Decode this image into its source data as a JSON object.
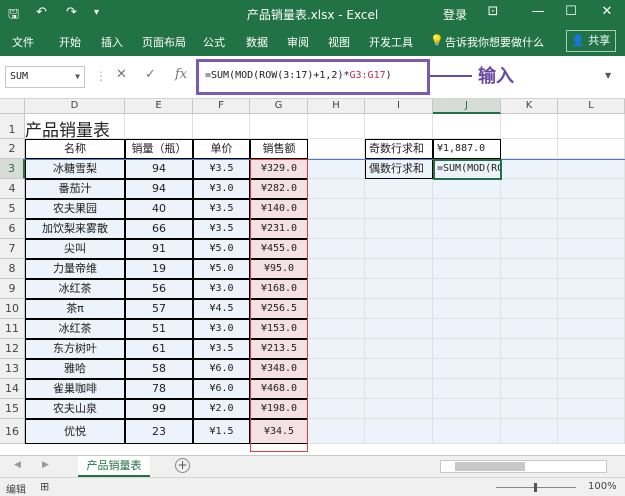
{
  "window": {
    "title": "产品销量表.xlsx - Excel",
    "login": "登录",
    "icons": [
      "save-icon",
      "undo-icon",
      "redo-icon",
      "customize-icon"
    ]
  },
  "ribbon": {
    "tabs": [
      "文件",
      "开始",
      "插入",
      "页面布局",
      "公式",
      "数据",
      "审阅",
      "视图",
      "开发工具"
    ],
    "tell_me": "告诉我你想要做什么",
    "share": "共享"
  },
  "formula_bar": {
    "name_box": "SUM",
    "fx_label": "fx",
    "formula_pre": "=SUM(MOD(ROW(3:17)+1,2)*",
    "formula_ref": "G3:G17",
    "formula_post": ")",
    "callout": "输入"
  },
  "sheet": {
    "columns": [
      "D",
      "E",
      "F",
      "G",
      "H",
      "I",
      "J",
      "K",
      "L"
    ],
    "row_numbers": [
      "1",
      "2",
      "3",
      "4",
      "5",
      "6",
      "7",
      "8",
      "9",
      "10",
      "11",
      "12",
      "13",
      "14",
      "15",
      "16"
    ],
    "title": "产品销量表",
    "headers": [
      "名称",
      "销量（瓶）",
      "单价",
      "销售额"
    ],
    "rows": [
      [
        "冰糖雪梨",
        "94",
        "¥3.5",
        "¥329.0"
      ],
      [
        "番茄汁",
        "94",
        "¥3.0",
        "¥282.0"
      ],
      [
        "农夫果园",
        "40",
        "¥3.5",
        "¥140.0"
      ],
      [
        "加饮梨来雾散",
        "66",
        "¥3.5",
        "¥231.0"
      ],
      [
        "尖叫",
        "91",
        "¥5.0",
        "¥455.0"
      ],
      [
        "力量帝维",
        "19",
        "¥5.0",
        "¥95.0"
      ],
      [
        "冰红茶",
        "56",
        "¥3.0",
        "¥168.0"
      ],
      [
        "茶π",
        "57",
        "¥4.5",
        "¥256.5"
      ],
      [
        "冰红茶",
        "51",
        "¥3.0",
        "¥153.0"
      ],
      [
        "东方树叶",
        "61",
        "¥3.5",
        "¥213.5"
      ],
      [
        "雅哈",
        "58",
        "¥6.0",
        "¥348.0"
      ],
      [
        "雀巢咖啡",
        "78",
        "¥6.0",
        "¥468.0"
      ],
      [
        "农夫山泉",
        "99",
        "¥2.0",
        "¥198.0"
      ],
      [
        "优悦",
        "23",
        "¥1.5",
        "¥34.5"
      ]
    ],
    "summary": [
      {
        "label": "奇数行求和",
        "value": "¥1,887.0"
      },
      {
        "label": "偶数行求和",
        "value": "=SUM(MOD(RO"
      }
    ]
  },
  "sheet_tabs": {
    "active": "产品销量表",
    "add_icon": "plus-icon"
  },
  "status_bar": {
    "mode": "编辑",
    "zoom": "100%"
  }
}
